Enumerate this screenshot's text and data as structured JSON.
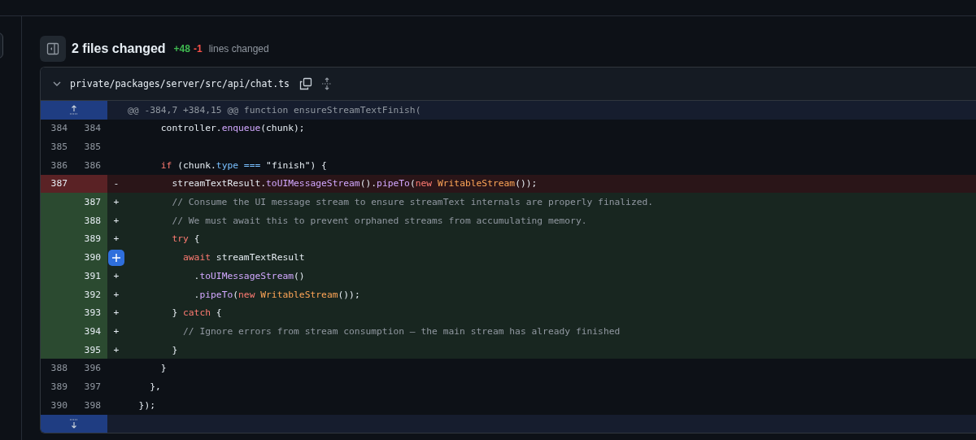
{
  "summary": {
    "title": "2 files changed",
    "additions": "+48",
    "deletions": "-1",
    "label": "lines changed"
  },
  "file": {
    "path": "private/packages/server/src/api/chat.ts",
    "expanded": true,
    "hunk": "@@ -384,7 +384,15 @@ function ensureStreamTextFinish(",
    "lines": [
      {
        "kind": "context",
        "old": "384",
        "new": "384",
        "tokens": [
          {
            "t": "      controller.",
            "kind": "plain"
          },
          {
            "t": "enqueue",
            "kind": "func"
          },
          {
            "t": "(chunk);",
            "kind": "plain"
          }
        ]
      },
      {
        "kind": "context",
        "old": "385",
        "new": "385"
      },
      {
        "kind": "context",
        "old": "386",
        "new": "386",
        "tokens": [
          {
            "t": "      if",
            "kind": "keyword"
          },
          {
            "t": " (chunk.",
            "kind": "plain"
          },
          {
            "t": "type",
            "kind": "prop"
          },
          {
            "t": " ===",
            "kind": "prop"
          },
          {
            "t": " \"finish\") {",
            "kind": "plain"
          }
        ]
      },
      {
        "kind": "deletion",
        "old": "387",
        "marker": "-",
        "tokens": [
          {
            "t": "        streamTextResult.",
            "kind": "plain"
          },
          {
            "t": "toUIMessageStream",
            "kind": "func"
          },
          {
            "t": "().",
            "kind": "plain"
          },
          {
            "t": "pipeTo",
            "kind": "func"
          },
          {
            "t": "(",
            "kind": "plain"
          },
          {
            "t": "new ",
            "kind": "keyword"
          },
          {
            "t": "WritableStream",
            "kind": "class"
          },
          {
            "t": "());",
            "kind": "plain"
          }
        ]
      },
      {
        "kind": "addition",
        "new": "387",
        "marker": "+",
        "tokens": [
          {
            "t": "        // Consume the UI message stream to ensure streamText internals are properly finalized.",
            "kind": "comment"
          }
        ]
      },
      {
        "kind": "addition",
        "new": "388",
        "marker": "+",
        "tokens": [
          {
            "t": "        // We must await this to prevent orphaned streams from accumulating memory.",
            "kind": "comment"
          }
        ]
      },
      {
        "kind": "addition",
        "new": "389",
        "marker": "+",
        "tokens": [
          {
            "t": "        try",
            "kind": "keyword"
          },
          {
            "t": " {",
            "kind": "plain"
          }
        ]
      },
      {
        "kind": "addition",
        "new": "390",
        "comment_button": true,
        "tokens": [
          {
            "t": "          await",
            "kind": "keyword"
          },
          {
            "t": " streamTextResult",
            "kind": "plain"
          }
        ]
      },
      {
        "kind": "addition",
        "new": "391",
        "marker": "+",
        "tokens": [
          {
            "t": "            .",
            "kind": "plain"
          },
          {
            "t": "toUIMessageStream",
            "kind": "func"
          },
          {
            "t": "()",
            "kind": "plain"
          }
        ]
      },
      {
        "kind": "addition",
        "new": "392",
        "marker": "+",
        "tokens": [
          {
            "t": "            .",
            "kind": "plain"
          },
          {
            "t": "pipeTo",
            "kind": "func"
          },
          {
            "t": "(",
            "kind": "plain"
          },
          {
            "t": "new ",
            "kind": "keyword"
          },
          {
            "t": "WritableStream",
            "kind": "class"
          },
          {
            "t": "());",
            "kind": "plain"
          }
        ]
      },
      {
        "kind": "addition",
        "new": "393",
        "marker": "+",
        "tokens": [
          {
            "t": "        } ",
            "kind": "plain"
          },
          {
            "t": "catch",
            "kind": "keyword"
          },
          {
            "t": " {",
            "kind": "plain"
          }
        ]
      },
      {
        "kind": "addition",
        "new": "394",
        "marker": "+",
        "tokens": [
          {
            "t": "          // Ignore errors from stream consumption – the main stream has already finished",
            "kind": "comment"
          }
        ]
      },
      {
        "kind": "addition",
        "new": "395",
        "marker": "+",
        "tokens": [
          {
            "t": "        }",
            "kind": "plain"
          }
        ]
      },
      {
        "kind": "context",
        "old": "388",
        "new": "396",
        "tokens": [
          {
            "t": "      }",
            "kind": "plain"
          }
        ]
      },
      {
        "kind": "context",
        "old": "389",
        "new": "397",
        "tokens": [
          {
            "t": "    },",
            "kind": "plain"
          }
        ]
      },
      {
        "kind": "context",
        "old": "390",
        "new": "398",
        "tokens": [
          {
            "t": "  });",
            "kind": "plain"
          }
        ]
      }
    ]
  }
}
